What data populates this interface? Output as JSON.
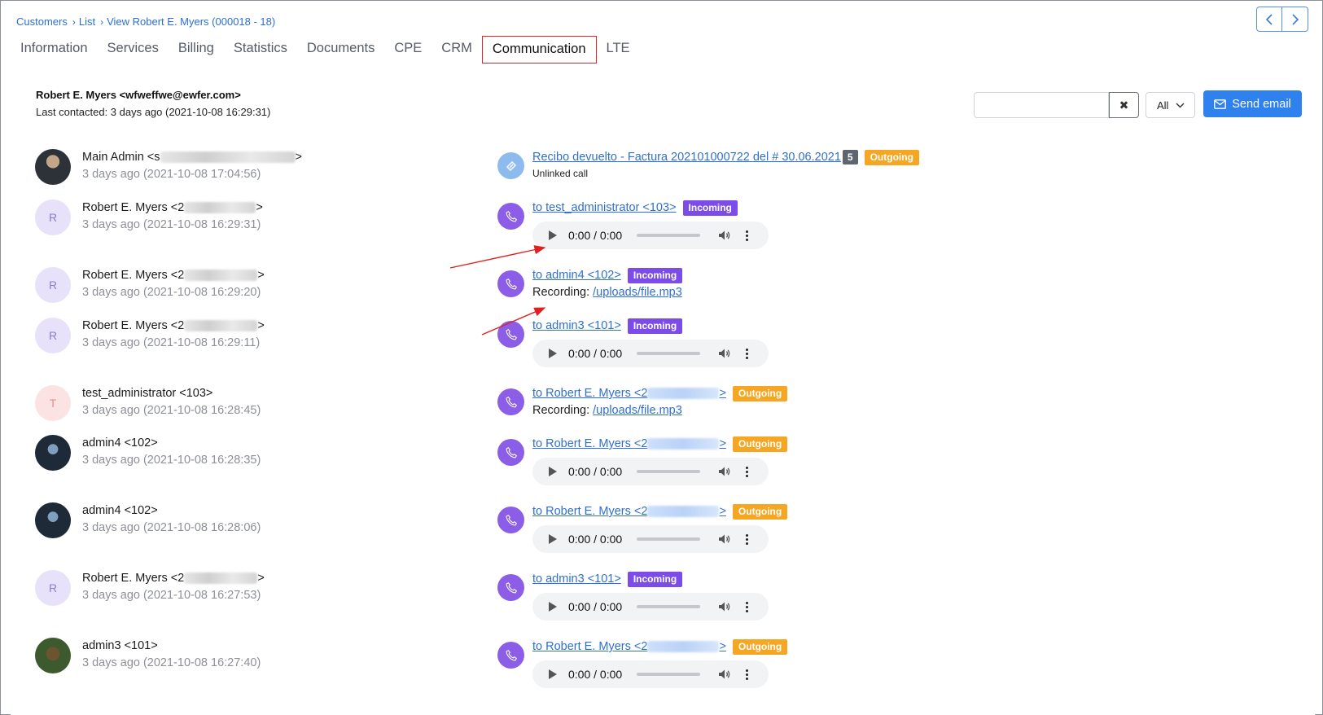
{
  "breadcrumb": [
    "Customers",
    "List",
    "View Robert E. Myers (000018 - 18)"
  ],
  "tabs": [
    "Information",
    "Services",
    "Billing",
    "Statistics",
    "Documents",
    "CPE",
    "CRM",
    "Communication",
    "LTE"
  ],
  "active_tab": "Communication",
  "customer": {
    "name": "Robert E. Myers <wfweffwe@ewfer.com>",
    "last_contacted": "Last contacted: 3 days ago (2021-10-08 16:29:31)"
  },
  "toolbar": {
    "search_value": "",
    "clear_icon": "✖",
    "filter_value": "All",
    "send_label": "Send email"
  },
  "senders": [
    {
      "prefix": "Main Admin <s",
      "suffix": ">",
      "when": "3 days ago (2021-10-08 17:04:56)",
      "avatar": "photo"
    },
    {
      "prefix": "Robert E. Myers <2",
      "suffix": ">",
      "when": "3 days ago (2021-10-08 16:29:31)",
      "avatar": "R"
    },
    {
      "prefix": "Robert E. Myers <2",
      "suffix": ">",
      "when": "3 days ago (2021-10-08 16:29:20)",
      "avatar": "R"
    },
    {
      "prefix": "Robert E. Myers <2",
      "suffix": ">",
      "when": "3 days ago (2021-10-08 16:29:11)",
      "avatar": "R"
    },
    {
      "prefix": "test_administrator <103>",
      "suffix": "",
      "when": "3 days ago (2021-10-08 16:28:45)",
      "avatar": "T"
    },
    {
      "prefix": "admin4 <102>",
      "suffix": "",
      "when": "3 days ago (2021-10-08 16:28:35)",
      "avatar": "photo"
    },
    {
      "prefix": "admin4 <102>",
      "suffix": "",
      "when": "3 days ago (2021-10-08 16:28:06)",
      "avatar": "photo"
    },
    {
      "prefix": "Robert E. Myers <2",
      "suffix": ">",
      "when": "3 days ago (2021-10-08 16:27:53)",
      "avatar": "R"
    },
    {
      "prefix": "admin3 <101>",
      "suffix": "",
      "when": "3 days ago (2021-10-08 16:27:40)",
      "avatar": "photo"
    }
  ],
  "entries": [
    {
      "title": "Recibo devuelto - Factura 202101000722 del # 30.06.2021",
      "count": "5",
      "badge": "Outgoing",
      "subtext": "Unlinked call"
    },
    {
      "title": "to test_administrator <103>",
      "badge": "Incoming",
      "player_time": "0:00 / 0:00"
    },
    {
      "title": "to admin4 <102>",
      "badge": "Incoming",
      "recording_label": "Recording:",
      "recording_link": "/uploads/file.mp3"
    },
    {
      "title": "to admin3 <101>",
      "badge": "Incoming",
      "player_time": "0:00 / 0:00"
    },
    {
      "title_prefix": "to Robert E. Myers <2",
      "title_suffix": ">",
      "badge": "Outgoing",
      "recording_label": "Recording:",
      "recording_link": "/uploads/file.mp3"
    },
    {
      "title_prefix": "to Robert E. Myers <2",
      "title_suffix": ">",
      "badge": "Outgoing",
      "player_time": "0:00 / 0:00"
    },
    {
      "title_prefix": "to Robert E. Myers <2",
      "title_suffix": ">",
      "badge": "Outgoing",
      "player_time": "0:00 / 0:00"
    },
    {
      "title": "to admin3 <101>",
      "badge": "Incoming",
      "player_time": "0:00 / 0:00"
    },
    {
      "title_prefix": "to Robert E. Myers <2",
      "title_suffix": ">",
      "badge": "Outgoing",
      "player_time": "0:00 / 0:00"
    }
  ],
  "colors": {
    "accent": "#2f81ee",
    "incoming": "#7c4ce8",
    "outgoing": "#f5a623",
    "call_icon": "#8c5ee8",
    "active_tab_border": "#e0262c"
  }
}
